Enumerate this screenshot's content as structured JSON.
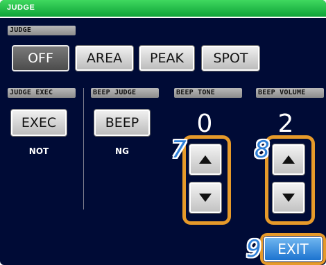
{
  "window": {
    "title": "JUDGE"
  },
  "judge": {
    "section_label": "JUDGE",
    "options": [
      "OFF",
      "AREA",
      "PEAK",
      "SPOT"
    ],
    "selected": "OFF"
  },
  "judge_exec": {
    "label": "JUDGE EXEC",
    "button": "EXEC",
    "status": "NOT"
  },
  "beep_judge": {
    "label": "BEEP JUDGE",
    "button": "BEEP",
    "status": "NG"
  },
  "beep_tone": {
    "label": "BEEP TONE",
    "value": "0",
    "callout": "7"
  },
  "beep_volume": {
    "label": "BEEP VOLUME",
    "value": "2",
    "callout": "8"
  },
  "exit": {
    "label": "EXIT",
    "callout": "9"
  },
  "colors": {
    "background": "#000b36",
    "title_bar": "#0ea338",
    "highlight_frame": "#e69a2a",
    "callout_number": "#2f7fd6",
    "exit_button": "#1c73cf"
  },
  "icons": {
    "up": "triangle-up-icon",
    "down": "triangle-down-icon"
  }
}
